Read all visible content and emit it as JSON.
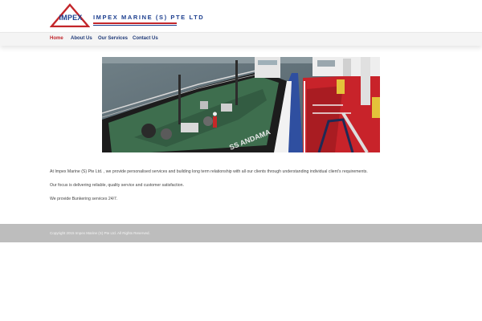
{
  "header": {
    "logo": {
      "mark_text": "IMPEX",
      "company_text": "IMPEX  MARINE  (S)  PTE  LTD",
      "brand_red": "#c3262a",
      "brand_blue": "#1d3f8f"
    }
  },
  "nav": {
    "items": [
      {
        "label": "Home",
        "active": true
      },
      {
        "label": "About Us",
        "active": false
      },
      {
        "label": "Our Services",
        "active": false
      },
      {
        "label": "Contact Us",
        "active": false
      }
    ],
    "active_color": "#c1272d",
    "link_color": "#1f3a78"
  },
  "hero": {
    "hull_text": "SS ANDAMA"
  },
  "content": {
    "paragraphs": [
      "At Impex Marine (S) Pte Ltd. , we provide personalised services and building long term relationship with all our clients through understanding individual client’s requirements.",
      "Our focus is delivering reliable, quality service and customer satisfaction.",
      "We provide Bunkering services 24/7."
    ]
  },
  "footer": {
    "copyright": "Copyright 2015 Impex Marine (S) Pte Ltd. All Rights Reserved.",
    "background": "#bdbdbd"
  }
}
